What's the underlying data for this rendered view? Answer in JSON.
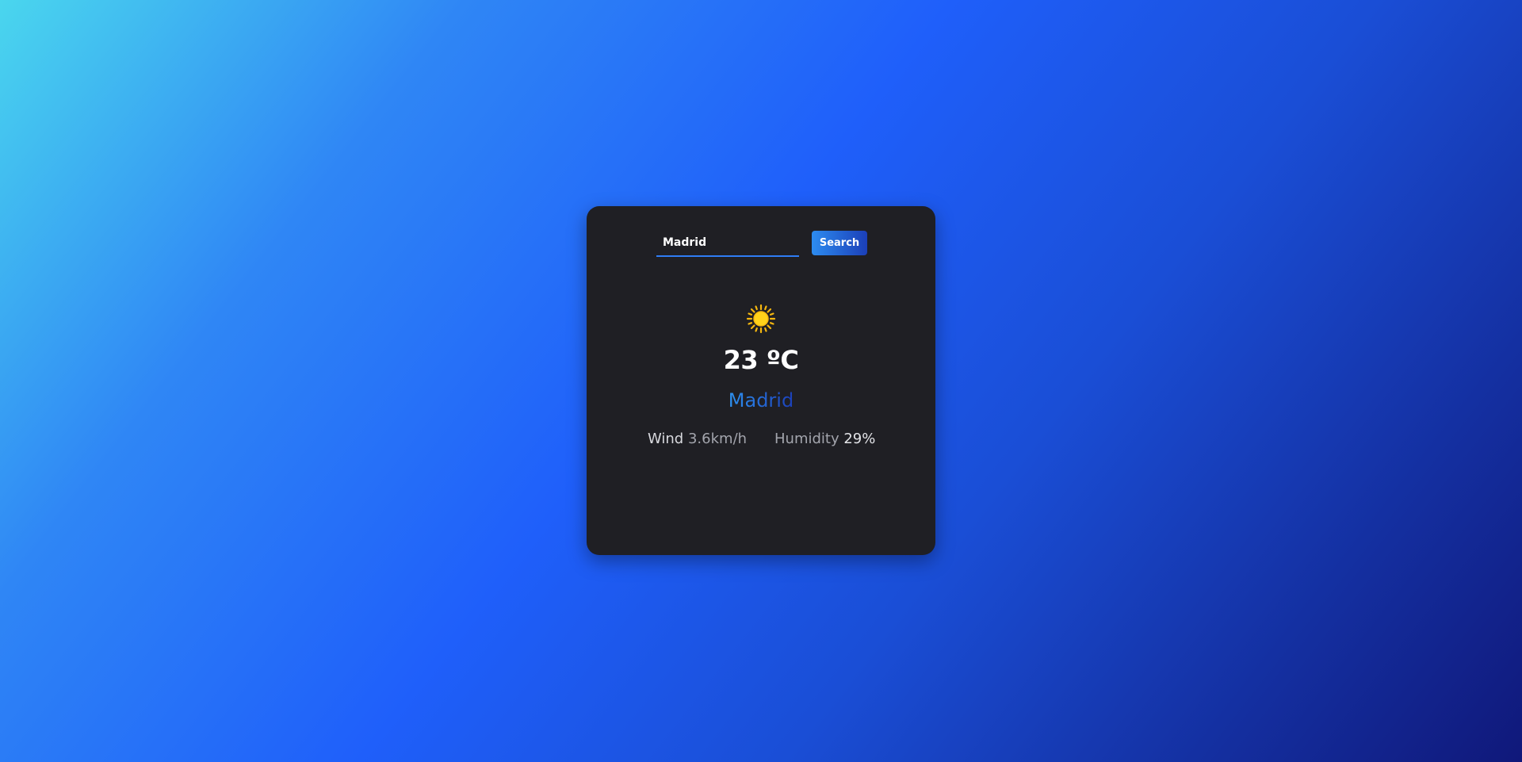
{
  "search": {
    "value": "Madrid",
    "button_label": "Search"
  },
  "weather": {
    "icon": "sun-icon",
    "temperature": "23 ºC",
    "city": "Madrid",
    "wind_label": "Wind",
    "wind_value": "3.6km/h",
    "humidity_label": "Humidity",
    "humidity_value": "29%"
  },
  "colors": {
    "card_background": "#1f1f24",
    "accent": "#2f7df5",
    "sun": "#f5c518"
  }
}
